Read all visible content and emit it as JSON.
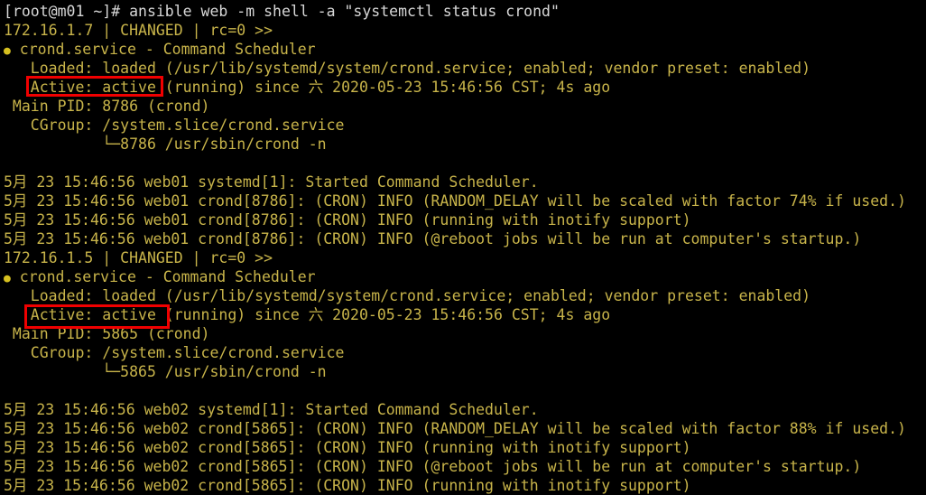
{
  "terminal": {
    "title": "root@m01:~",
    "background_color": "#000000",
    "text_color": "#c8b44a",
    "command_color": "#d8d8d8",
    "highlight_color": "#f00000",
    "bullet_color": "#d6c020",
    "prompt": "[root@m01 ~]#",
    "command": " ansible web -m shell -a \"systemctl status crond\"",
    "prompt_line": "[root@m01 ~]# ansible web -m shell -a \"systemctl status crond\"",
    "lines": [
      {
        "id": "prompt-line",
        "kind": "command",
        "text": "[root@m01 ~]# ansible web -m shell -a \"systemctl status crond\""
      },
      {
        "id": "host1-status",
        "kind": "output",
        "text": "172.16.1.7 | CHANGED | rc=0 >>"
      },
      {
        "id": "host1-unit",
        "kind": "bullet",
        "bullet": "●",
        "text": " crond.service - Command Scheduler"
      },
      {
        "id": "host1-loaded",
        "kind": "output",
        "text": "   Loaded: loaded (/usr/lib/systemd/system/crond.service; enabled; vendor preset: enabled)"
      },
      {
        "id": "host1-active",
        "kind": "output",
        "text": "   Active: active (running) since 六 2020-05-23 15:46:56 CST; 4s ago"
      },
      {
        "id": "host1-mainpid",
        "kind": "output",
        "text": " Main PID: 8786 (crond)"
      },
      {
        "id": "host1-cgroup",
        "kind": "output",
        "text": "   CGroup: /system.slice/crond.service"
      },
      {
        "id": "host1-cgroup-proc",
        "kind": "output",
        "text": "           └─8786 /usr/sbin/crond -n"
      },
      {
        "id": "host1-gap",
        "kind": "blank",
        "text": " "
      },
      {
        "id": "host1-log-1",
        "kind": "output",
        "text": "5月 23 15:46:56 web01 systemd[1]: Started Command Scheduler."
      },
      {
        "id": "host1-log-2",
        "kind": "output",
        "text": "5月 23 15:46:56 web01 crond[8786]: (CRON) INFO (RANDOM_DELAY will be scaled with factor 74% if used.)"
      },
      {
        "id": "host1-log-3",
        "kind": "output",
        "text": "5月 23 15:46:56 web01 crond[8786]: (CRON) INFO (running with inotify support)"
      },
      {
        "id": "host1-log-4",
        "kind": "output",
        "text": "5月 23 15:46:56 web01 crond[8786]: (CRON) INFO (@reboot jobs will be run at computer's startup.)"
      },
      {
        "id": "host2-status",
        "kind": "output",
        "text": "172.16.1.5 | CHANGED | rc=0 >>"
      },
      {
        "id": "host2-unit",
        "kind": "bullet",
        "bullet": "●",
        "text": " crond.service - Command Scheduler"
      },
      {
        "id": "host2-loaded",
        "kind": "output",
        "text": "   Loaded: loaded (/usr/lib/systemd/system/crond.service; enabled; vendor preset: enabled)"
      },
      {
        "id": "host2-active",
        "kind": "output",
        "text": "   Active: active (running) since 六 2020-05-23 15:46:56 CST; 4s ago"
      },
      {
        "id": "host2-mainpid",
        "kind": "output",
        "text": " Main PID: 5865 (crond)"
      },
      {
        "id": "host2-cgroup",
        "kind": "output",
        "text": "   CGroup: /system.slice/crond.service"
      },
      {
        "id": "host2-cgroup-proc",
        "kind": "output",
        "text": "           └─5865 /usr/sbin/crond -n"
      },
      {
        "id": "host2-gap",
        "kind": "blank",
        "text": " "
      },
      {
        "id": "host2-log-1",
        "kind": "output",
        "text": "5月 23 15:46:56 web02 systemd[1]: Started Command Scheduler."
      },
      {
        "id": "host2-log-2",
        "kind": "output",
        "text": "5月 23 15:46:56 web02 crond[5865]: (CRON) INFO (RANDOM_DELAY will be scaled with factor 88% if used.)"
      },
      {
        "id": "host2-log-3",
        "kind": "output",
        "text": "5月 23 15:46:56 web02 crond[5865]: (CRON) INFO (running with inotify support)"
      },
      {
        "id": "host2-log-5",
        "kind": "output",
        "text": "5月 23 15:46:56 web02 crond[5865]: (CRON) INFO (@reboot jobs will be run at computer's startup.)"
      },
      {
        "id": "host2-log-6-clipped",
        "kind": "output",
        "text": "5月 23 15:46:56 web02 crond[5865]: (CRON) INFO (running with inotify support)"
      }
    ],
    "highlights": [
      {
        "id": "highlight-active-host1",
        "label": "Active: active",
        "target_line": "host1-active"
      },
      {
        "id": "highlight-active-host2",
        "label": "Active: active",
        "target_line": "host2-active"
      }
    ],
    "hosts": [
      {
        "ip": "172.16.1.7",
        "result": "CHANGED",
        "rc": "rc=0 >>",
        "hostname": "web01",
        "unit": "crond.service",
        "description": "Command Scheduler",
        "loaded": "loaded (/usr/lib/systemd/system/crond.service; enabled; vendor preset: enabled)",
        "active": "active (running) since 六 2020-05-23 15:46:56 CST; 4s ago",
        "main_pid": "8786 (crond)",
        "cgroup": "/system.slice/crond.service",
        "cgroup_process": "8786 /usr/sbin/crond -n",
        "random_delay_factor": "74%"
      },
      {
        "ip": "172.16.1.5",
        "result": "CHANGED",
        "rc": "rc=0 >>",
        "hostname": "web02",
        "unit": "crond.service",
        "description": "Command Scheduler",
        "loaded": "loaded (/usr/lib/systemd/system/crond.service; enabled; vendor preset: enabled)",
        "active": "active (running) since 六 2020-05-23 15:46:56 CST; 4s ago",
        "main_pid": "5865 (crond)",
        "cgroup": "/system.slice/crond.service",
        "cgroup_process": "5865 /usr/sbin/crond -n",
        "random_delay_factor": "88%"
      }
    ]
  }
}
